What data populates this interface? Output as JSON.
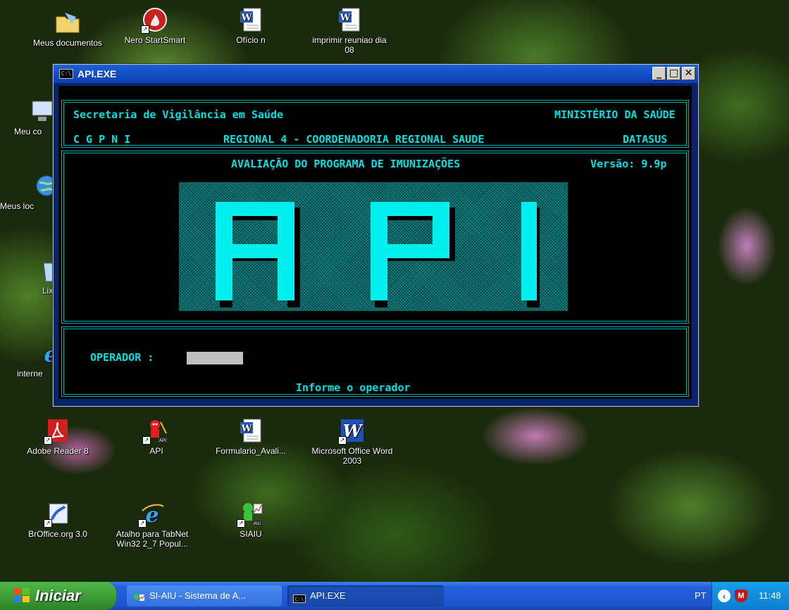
{
  "desktop": {
    "icons": [
      {
        "label": "Meus documentos"
      },
      {
        "label": "Nero StartSmart"
      },
      {
        "label": "Ofício n"
      },
      {
        "label": "imprimir reuniao dia 08"
      },
      {
        "label": "Meu co"
      },
      {
        "label": "Meus loc"
      },
      {
        "label": "Lix"
      },
      {
        "label": "interne"
      },
      {
        "label": "Adobe Reader 8"
      },
      {
        "label": "API"
      },
      {
        "label": "Formulario_Avali..."
      },
      {
        "label": "Microsoft Office Word 2003"
      },
      {
        "label": "BrOffice.org 3.0"
      },
      {
        "label": "Atalho para TabNet Win32 2_7 Popul..."
      },
      {
        "label": "SIAIU"
      }
    ]
  },
  "window": {
    "title": "API.EXE",
    "console_icon_text": "C:\\",
    "minimize_glyph": "_",
    "maximize_glyph": "□",
    "close_glyph": "✕",
    "header": {
      "left_top": "Secretaria de Vigilância em Saúde",
      "right_top": "MINISTÉRIO DA SAÚDE",
      "left_bottom": "C G P N I",
      "center_bottom": "REGIONAL 4 - COORDENADORIA REGIONAL SAUDE",
      "right_bottom": "DATASUS"
    },
    "program_title": "AVALIAÇÃO DO PROGRAMA DE IMUNIZAÇÕES",
    "version": "Versão: 9.9p",
    "login": {
      "operator_label": "OPERADOR :",
      "operator_value": "",
      "status_message": "Informe o operador"
    }
  },
  "taskbar": {
    "start_label": "Iniciar",
    "tasks": [
      {
        "label": "SI-AIU - Sistema de A..."
      },
      {
        "label": "API.EXE"
      }
    ],
    "language": "PT",
    "clock": "11:48"
  },
  "colors": {
    "console_cyan": "#00e0e0",
    "banner_teal": "#0a8a8a",
    "taskbar_blue": "#245edb",
    "start_green": "#3a9a35"
  }
}
